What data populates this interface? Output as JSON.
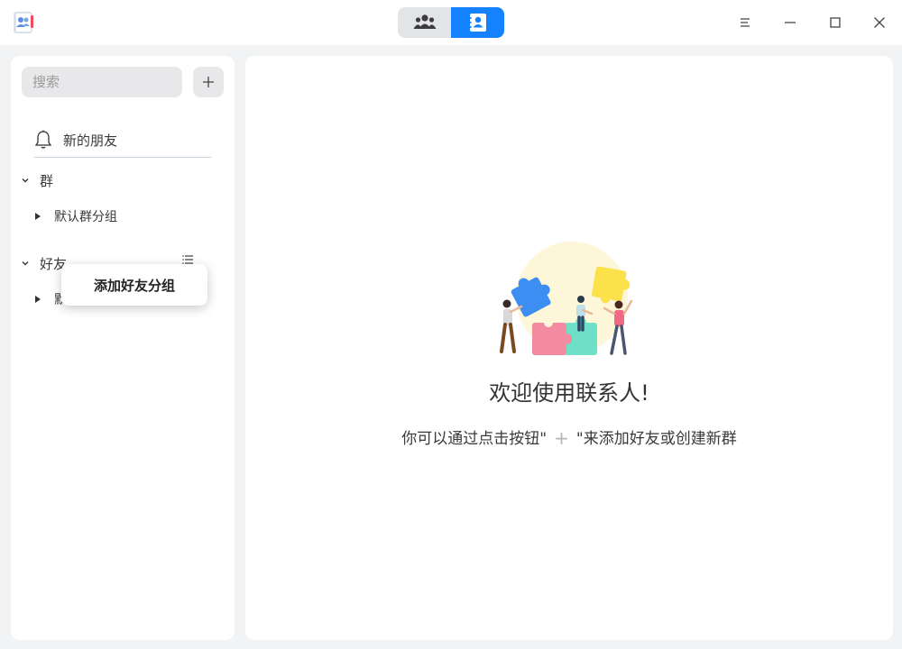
{
  "titlebar": {
    "logo_icon": "contacts-app-icon",
    "view_toggle": [
      {
        "name": "groups-view",
        "icon": "people-group-icon",
        "active": false
      },
      {
        "name": "contacts-view",
        "icon": "contact-card-icon",
        "active": true
      }
    ],
    "window_controls": [
      "menu-icon",
      "minimize-icon",
      "maximize-icon",
      "close-icon"
    ]
  },
  "sidebar": {
    "search_placeholder": "搜索",
    "add_button_icon": "plus-icon",
    "new_friends_label": "新的朋友",
    "groups_section": {
      "label": "群",
      "items": [
        {
          "label": "默认群分组"
        }
      ]
    },
    "friends_section": {
      "label": "好友",
      "items": [
        {
          "label": "默认"
        }
      ]
    }
  },
  "context_menu": {
    "items": [
      {
        "label": "添加好友分组"
      }
    ]
  },
  "main": {
    "welcome_title": "欢迎使用联系人!",
    "hint_prefix": "你可以通过点击按钮\"",
    "hint_plus": "+",
    "hint_suffix": "\"来添加好友或创建新群"
  },
  "colors": {
    "accent": "#1482ff",
    "background": "#f2f3f5",
    "panel": "#ffffff"
  }
}
